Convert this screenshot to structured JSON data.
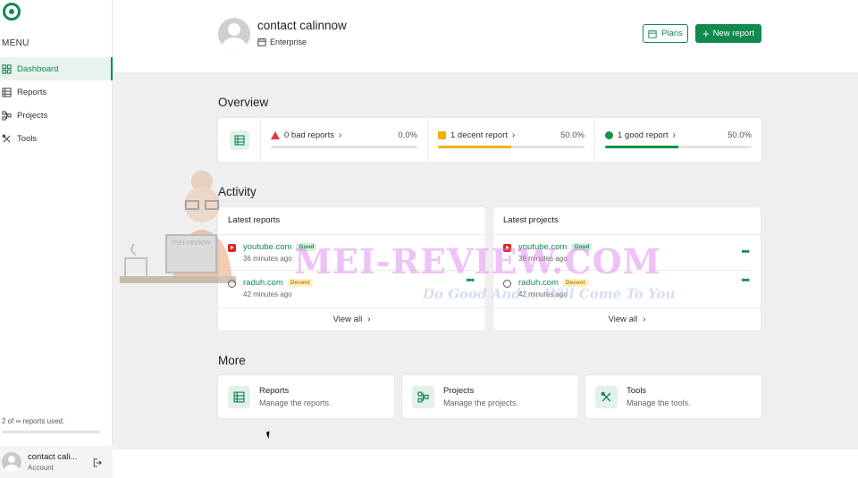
{
  "sidebar": {
    "menu_title": "MENU",
    "items": [
      {
        "label": "Dashboard",
        "icon": "dashboard-icon",
        "active": true
      },
      {
        "label": "Reports",
        "icon": "reports-icon",
        "active": false
      },
      {
        "label": "Projects",
        "icon": "projects-icon",
        "active": false
      },
      {
        "label": "Tools",
        "icon": "tools-icon",
        "active": false
      }
    ],
    "usage_text": "2 of ∞ reports used.",
    "usage_fraction": 0.0,
    "account": {
      "name": "contact cali...",
      "sub": "Account"
    }
  },
  "header": {
    "user_name": "contact calinnow",
    "plan": "Enterprise",
    "plans_button": "Plans",
    "new_report_button": "New report"
  },
  "overview": {
    "title": "Overview",
    "stats": [
      {
        "label": "0 bad reports",
        "percent": "0.0%",
        "value": 0.0,
        "color": "#e03b3b"
      },
      {
        "label": "1 decent report",
        "percent": "50.0%",
        "value": 0.5,
        "color": "#f0b400"
      },
      {
        "label": "1 good report",
        "percent": "50.0%",
        "value": 0.5,
        "color": "#139443"
      }
    ]
  },
  "activity": {
    "title": "Activity",
    "latest_reports": {
      "title": "Latest reports",
      "items": [
        {
          "site": "youtube.com",
          "badge": "Good",
          "time": "36 minutes ago",
          "icon": "youtube-icon"
        },
        {
          "site": "raduh.com",
          "badge": "Decent",
          "time": "42 minutes ago",
          "icon": "wordpress-icon"
        }
      ],
      "view_all": "View all"
    },
    "latest_projects": {
      "title": "Latest projects",
      "items": [
        {
          "site": "youtube.com",
          "badge": "Good",
          "time": "36 minutes ago",
          "icon": "youtube-icon"
        },
        {
          "site": "raduh.com",
          "badge": "Decent",
          "time": "42 minutes ago",
          "icon": "wordpress-icon"
        }
      ],
      "view_all": "View all"
    }
  },
  "more": {
    "title": "More",
    "cards": [
      {
        "title": "Reports",
        "desc": "Manage the reports."
      },
      {
        "title": "Projects",
        "desc": "Manage the projects."
      },
      {
        "title": "Tools",
        "desc": "Manage the tools."
      }
    ]
  },
  "watermark": {
    "main": "MEI-REVIEW.COM",
    "tagline": "Do Good And ... Will Come To You",
    "screen_text": "mei-review"
  },
  "colors": {
    "accent": "#11894f",
    "bad": "#e03b3b",
    "decent": "#f0b400",
    "good": "#139443"
  }
}
